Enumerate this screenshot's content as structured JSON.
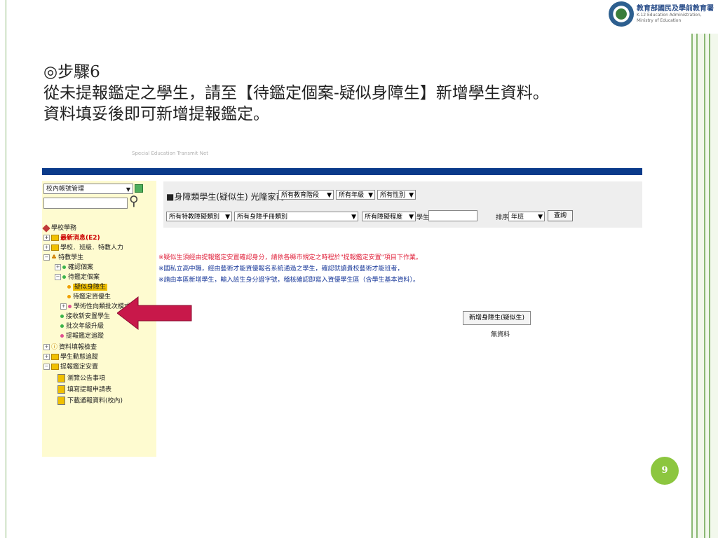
{
  "logo": {
    "org_cn": "教育部國民及學前教育署",
    "org_en_line1": "K-12 Education Administration,",
    "org_en_line2": "Ministry of Education"
  },
  "heading": {
    "step": "◎步驟6",
    "line1": "從未提報鑑定之學生，請至【待鑑定個案-疑似身障生】新增學生資料。",
    "line2": "資料填妥後即可新增提報鑑定。"
  },
  "screenshot": {
    "sidebar": {
      "account_select": "校內帳號管理",
      "tree": [
        {
          "label": "學校學務"
        },
        {
          "label": "最新消息(E2)"
        },
        {
          "label": "學校．班級．特教人力"
        },
        {
          "label": "特教學生"
        },
        {
          "label": "確認個案"
        },
        {
          "label": "待鑑定個案"
        },
        {
          "label": "疑似身障生"
        },
        {
          "label": "待鑑定資優生"
        },
        {
          "label": "學術性向類批次模式"
        },
        {
          "label": "接收新安置學生"
        },
        {
          "label": "批次年級升級"
        },
        {
          "label": "提報鑑定追蹤"
        },
        {
          "label": "資料填報檢查"
        },
        {
          "label": "學生動態追蹤"
        },
        {
          "label": "提報鑑定安置"
        },
        {
          "label": "瀏覽公告事項"
        },
        {
          "label": "填寫提報申請表"
        },
        {
          "label": "下載通報資料(校內)"
        }
      ]
    },
    "filter": {
      "title": "■身障類學生(疑似生) 光隆家商",
      "edu_stage": "所有教育階段",
      "grade": "所有年級",
      "gender": "所有性別",
      "special_category": "所有特教障礙類別",
      "handbook_category": "所有身障手冊類別",
      "severity": "所有障礙程度",
      "student_label": "學生",
      "sort_label": "排序",
      "sort_value": "年班",
      "query_button": "查詢"
    },
    "notices": [
      "※疑似生須經由提報鑑定安置確認身分，請依各縣市規定之時程於\"提報鑑定安置\"項目下作業。",
      "※國私立高中職，經由藝術才能資優報名系統通過之學生，確認就讀貴校藝術才能班者，",
      "※請由本區新增學生，輸入該生身分證字號，稽核確認即寫入資優學生區（含學生基本資料）。"
    ],
    "add_button": "新增身障生(疑似生)",
    "no_data": "無資料"
  },
  "page_number": "9"
}
